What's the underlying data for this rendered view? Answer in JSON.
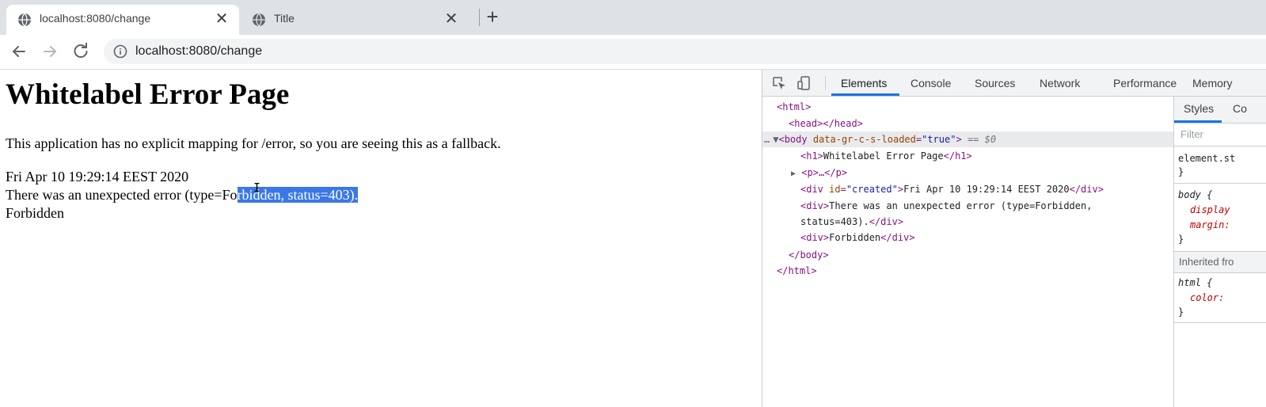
{
  "browser": {
    "tabs": [
      {
        "title": "localhost:8080/change",
        "close": "✕"
      },
      {
        "title": "Title",
        "close": "✕"
      }
    ],
    "new_tab": "+",
    "url": "localhost:8080/change"
  },
  "page": {
    "heading": "Whitelabel Error Page",
    "paragraph": "This application has no explicit mapping for /error, so you are seeing this as a fallback.",
    "created": "Fri Apr 10 19:29:14 EEST 2020",
    "error_before_selection": "There was an unexpected error (type=Fo",
    "error_selected": "rbidden, status=403).",
    "status_text": "Forbidden"
  },
  "devtools": {
    "tabs": [
      "Elements",
      "Console",
      "Sources",
      "Network",
      "Performance",
      "Memory"
    ],
    "active_tab": "Elements",
    "dom": {
      "html_open": "<html>",
      "head": "<head></head>",
      "body_dots": "…",
      "body_tag": "<body",
      "body_attr": "data-gr-c-s-loaded",
      "body_val": "\"true\"",
      "body_close": ">",
      "body_eq": "== $0",
      "h1_open": "<h1>",
      "h1_text": "Whitelabel Error Page",
      "h1_close": "</h1>",
      "p_collapsed": "<p>…</p>",
      "div_open": "<div",
      "div_attr": "id",
      "div_val": "\"created\"",
      "div_gt": ">",
      "div_text": "Fri Apr 10 19:29:14 EEST 2020",
      "div_close": "</div>",
      "div2_open": "<div>",
      "div2_text_1": "There was an unexpected error (type=Forbidden,",
      "div2_text_2": "status=403).",
      "div2_close": "</div>",
      "div3_open": "<div>",
      "div3_text": "Forbidden",
      "div3_close": "</div>",
      "body_end": "</body>",
      "html_end": "</html>"
    },
    "styles": {
      "tabs": [
        "Styles",
        "Co"
      ],
      "filter_placeholder": "Filter",
      "element_style": "element.st",
      "brace_close": "}",
      "body_selector": "body {",
      "body_prop_1": "display",
      "body_prop_2": "margin:",
      "inherited": "Inherited fro",
      "html_selector": "html {",
      "html_prop": "color:"
    }
  },
  "colors": {
    "selection": "#3b78e7",
    "active_tab_underline": "#1a73e8"
  }
}
